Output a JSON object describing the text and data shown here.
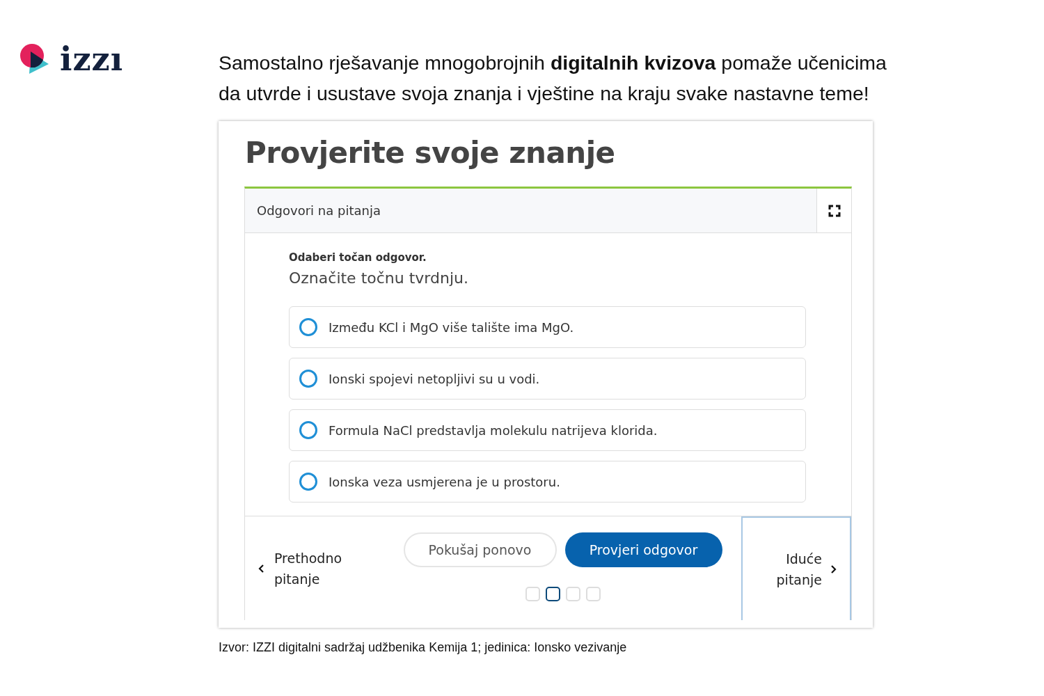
{
  "logo": {
    "text": "izzı"
  },
  "headline": "Samostalno rješavanje mnogobrojnih **digitalnih kvizova** pomaže učenicima da utvrde i usustave svoja znanja i vještine na kraju svake nastavne teme!",
  "quiz": {
    "title": "Provjerite svoje znanje",
    "panel_title": "Odgovori na pitanja",
    "instruction": "Odaberi točan odgovor.",
    "question": "Označite točnu tvrdnju.",
    "options": [
      {
        "text": "Između KCl i MgO više talište ima MgO.",
        "selected": false
      },
      {
        "text": "Ionski spojevi netopljivi su u vodi.",
        "selected": false
      },
      {
        "text": "Formula NaCl predstavlja molekulu natrijeva klorida.",
        "selected": false
      },
      {
        "text": "Ionska veza usmjerena je u prostoru.",
        "selected": false
      }
    ],
    "previous": "Prethodno pitanje",
    "retry": "Pokušaj ponovo",
    "check": "Provjeri odgovor",
    "next": "Iduće pitanje",
    "pages": [
      {
        "selected": false
      },
      {
        "selected": true
      },
      {
        "selected": false
      },
      {
        "selected": false
      }
    ]
  },
  "caption": "Izvor: IZZI digitalni sadržaj udžbenika Kemija 1; jedinica: Ionsko vezivanje"
}
